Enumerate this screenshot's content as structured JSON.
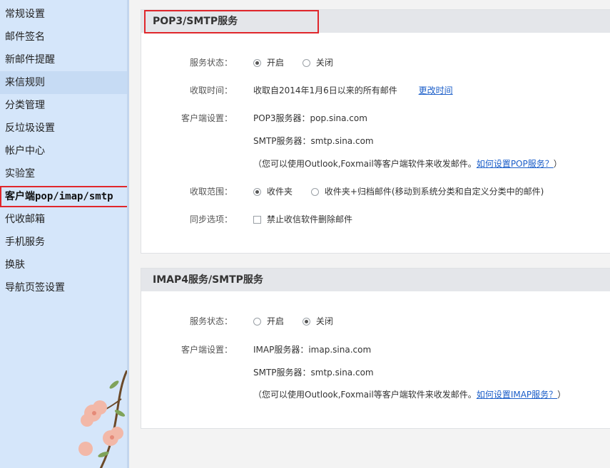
{
  "sidebar": {
    "items": [
      {
        "label": "常规设置"
      },
      {
        "label": "邮件签名"
      },
      {
        "label": "新邮件提醒"
      },
      {
        "label": "来信规则"
      },
      {
        "label": "分类管理"
      },
      {
        "label": "反垃圾设置"
      },
      {
        "label": "帐户中心"
      },
      {
        "label": "实验室"
      },
      {
        "label": "客户端pop/imap/smtp"
      },
      {
        "label": "代收邮箱"
      },
      {
        "label": "手机服务"
      },
      {
        "label": "换肤"
      },
      {
        "label": "导航页签设置"
      }
    ]
  },
  "pop": {
    "title": "POP3/SMTP服务",
    "status_label": "服务状态：",
    "status_on": "开启",
    "status_off": "关闭",
    "time_label": "收取时间：",
    "time_value": "收取自2014年1月6日以来的所有邮件",
    "time_link": "更改时间",
    "client_label": "客户端设置：",
    "pop_server": "POP3服务器：pop.sina.com",
    "smtp_server": "SMTP服务器：smtp.sina.com",
    "note_prefix": "（您可以使用Outlook,Foxmail等客户端软件来收发邮件。",
    "note_link": "如何设置POP服务？",
    "note_suffix": "）",
    "range_label": "收取范围：",
    "range_inbox": "收件夹",
    "range_all": "收件夹+归档邮件(移动到系统分类和自定义分类中的邮件)",
    "sync_label": "同步选项：",
    "sync_option": "禁止收信软件删除邮件"
  },
  "imap": {
    "title": "IMAP4服务/SMTP服务",
    "status_label": "服务状态：",
    "status_on": "开启",
    "status_off": "关闭",
    "client_label": "客户端设置：",
    "imap_server": "IMAP服务器：imap.sina.com",
    "smtp_server": "SMTP服务器：smtp.sina.com",
    "note_prefix": "（您可以使用Outlook,Foxmail等客户端软件来收发邮件。",
    "note_link": "如何设置IMAP服务？",
    "note_suffix": "）"
  }
}
